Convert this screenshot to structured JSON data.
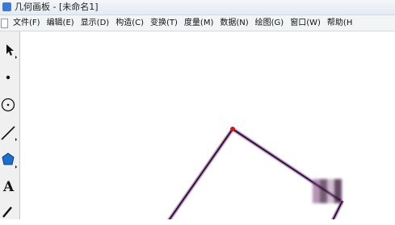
{
  "window": {
    "title": "几何画板 - [未命名1]"
  },
  "menu": {
    "items": [
      "文件(F)",
      "编辑(E)",
      "显示(D)",
      "构造(C)",
      "变换(T)",
      "度量(M)",
      "数据(N)",
      "绘图(G)",
      "窗口(W)",
      "帮助(H"
    ]
  },
  "tools": {
    "text_tool_glyph": "A"
  },
  "canvas": {
    "line_color": "#2a1430",
    "point_color": "#cc1a1a"
  }
}
